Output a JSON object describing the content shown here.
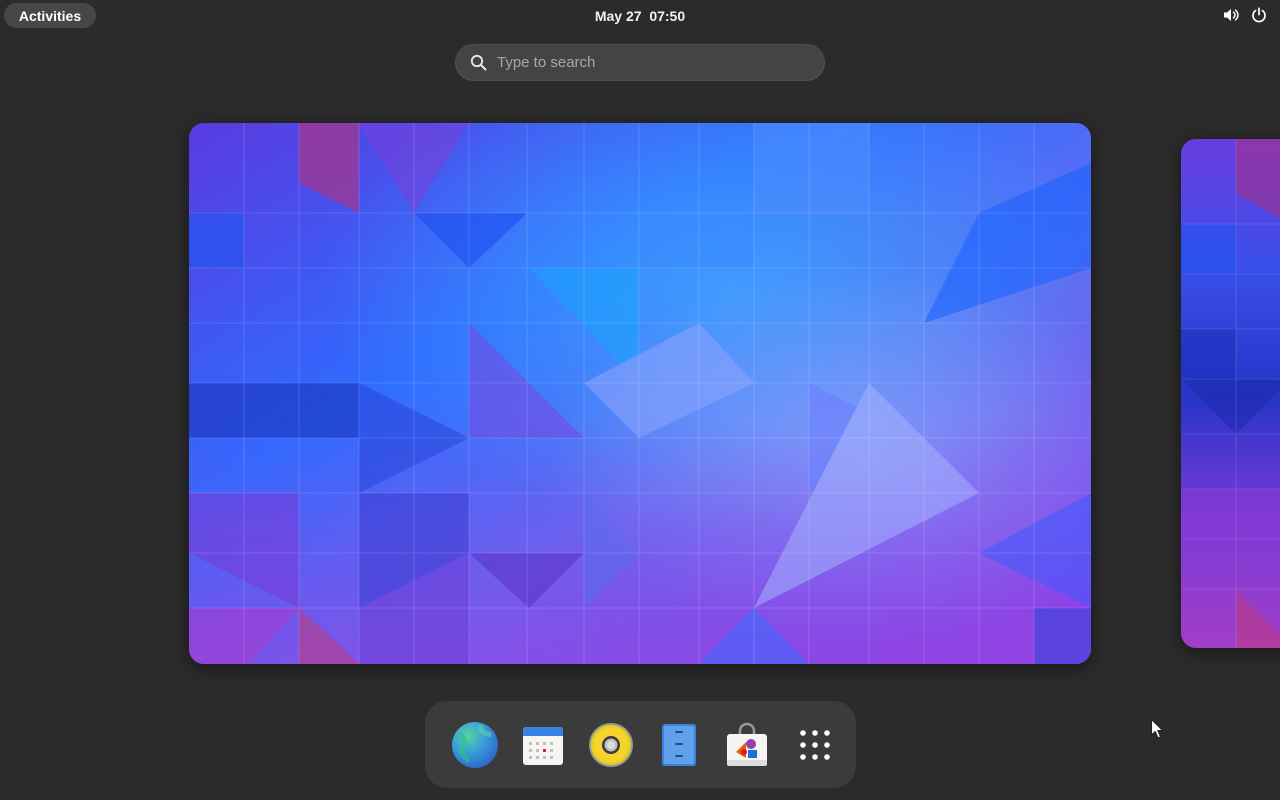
{
  "topbar": {
    "activities_label": "Activities",
    "clock": "May 27  07:50",
    "tray": {
      "volume_icon": "volume-icon",
      "power_icon": "power-icon"
    }
  },
  "search": {
    "placeholder": "Type to search",
    "value": ""
  },
  "workspaces": [
    {
      "name": "workspace-1",
      "active": true
    },
    {
      "name": "workspace-2",
      "active": false
    }
  ],
  "dash": {
    "apps": [
      {
        "icon": "web-browser-icon"
      },
      {
        "icon": "calendar-icon"
      },
      {
        "icon": "rhythmbox-speaker-icon"
      },
      {
        "icon": "file-manager-icon"
      },
      {
        "icon": "software-store-icon"
      },
      {
        "icon": "show-apps-grid-icon"
      }
    ]
  },
  "colors": {
    "panel_bg": "#2b2b2b",
    "search_bg": "#444444",
    "dash_bg": "#3b3b3b",
    "wallpaper_blue": "#2f6bff",
    "wallpaper_purple": "#8a3fe6"
  }
}
